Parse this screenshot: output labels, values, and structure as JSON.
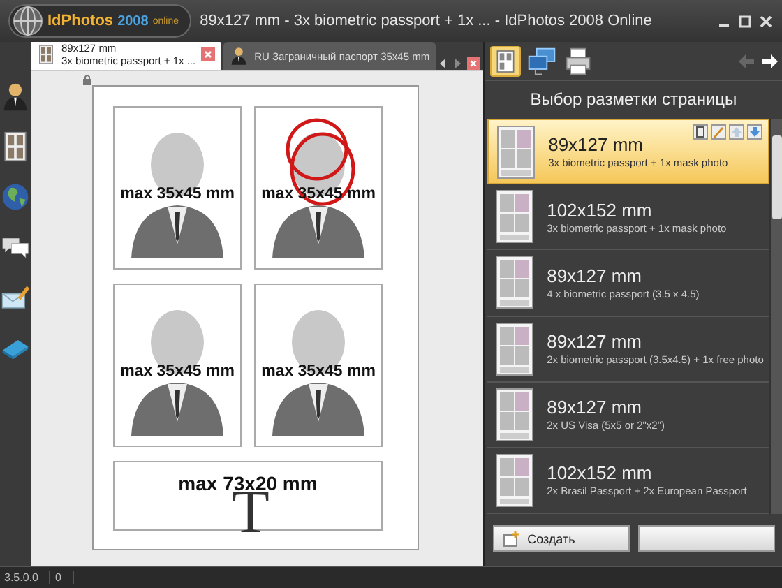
{
  "window": {
    "title": "89x127 mm - 3x biometric passport + 1x ... - IdPhotos 2008 Online"
  },
  "app_logo": {
    "name": "IdPhotos",
    "year": "2008",
    "edition": "online"
  },
  "tabs": [
    {
      "title": "89x127 mm",
      "subtitle": "3x biometric passport + 1x ...",
      "selected": true,
      "kind": "sheet"
    },
    {
      "title": "RU Заграничный паспорт 35x45 mm",
      "selected": false,
      "kind": "person"
    }
  ],
  "sidebar": {
    "items": [
      {
        "kind": "person"
      },
      {
        "kind": "sheet"
      },
      {
        "kind": "globe"
      },
      {
        "kind": "chat"
      },
      {
        "kind": "mail"
      },
      {
        "kind": "card"
      }
    ]
  },
  "page": {
    "slots": [
      {
        "kind": "photo",
        "label": "max 35x45 mm",
        "marked": false
      },
      {
        "kind": "photo",
        "label": "max 35x45 mm",
        "marked": true
      },
      {
        "kind": "photo",
        "label": "max 35x45 mm",
        "marked": false
      },
      {
        "kind": "photo",
        "label": "max 35x45 mm",
        "marked": false
      },
      {
        "kind": "signature",
        "label": "max 73x20 mm",
        "glyph": "T"
      }
    ]
  },
  "layout_panel": {
    "heading": "Выбор разметки страницы",
    "layouts": [
      {
        "size": "89x127 mm",
        "description": "3x biometric passport + 1x mask photo",
        "selected": true
      },
      {
        "size": "102x152 mm",
        "description": "3x biometric passport + 1x mask photo",
        "selected": false
      },
      {
        "size": "89x127 mm",
        "description": "4 x biometric passport (3.5 x 4.5)",
        "selected": false
      },
      {
        "size": "89x127 mm",
        "description": "2x biometric passport (3.5x4.5) + 1x free photo",
        "selected": false
      },
      {
        "size": "89x127 mm",
        "description": "2x US Visa (5x5 or 2\"x2\")",
        "selected": false
      },
      {
        "size": "102x152 mm",
        "description": "2x Brasil Passport + 2x European Passport",
        "selected": false
      }
    ],
    "buttons": [
      {
        "kind": "create",
        "label": "Создать"
      },
      {
        "kind": "plain"
      }
    ]
  },
  "status_bar": {
    "version": "3.5.0.0",
    "count": "0"
  }
}
